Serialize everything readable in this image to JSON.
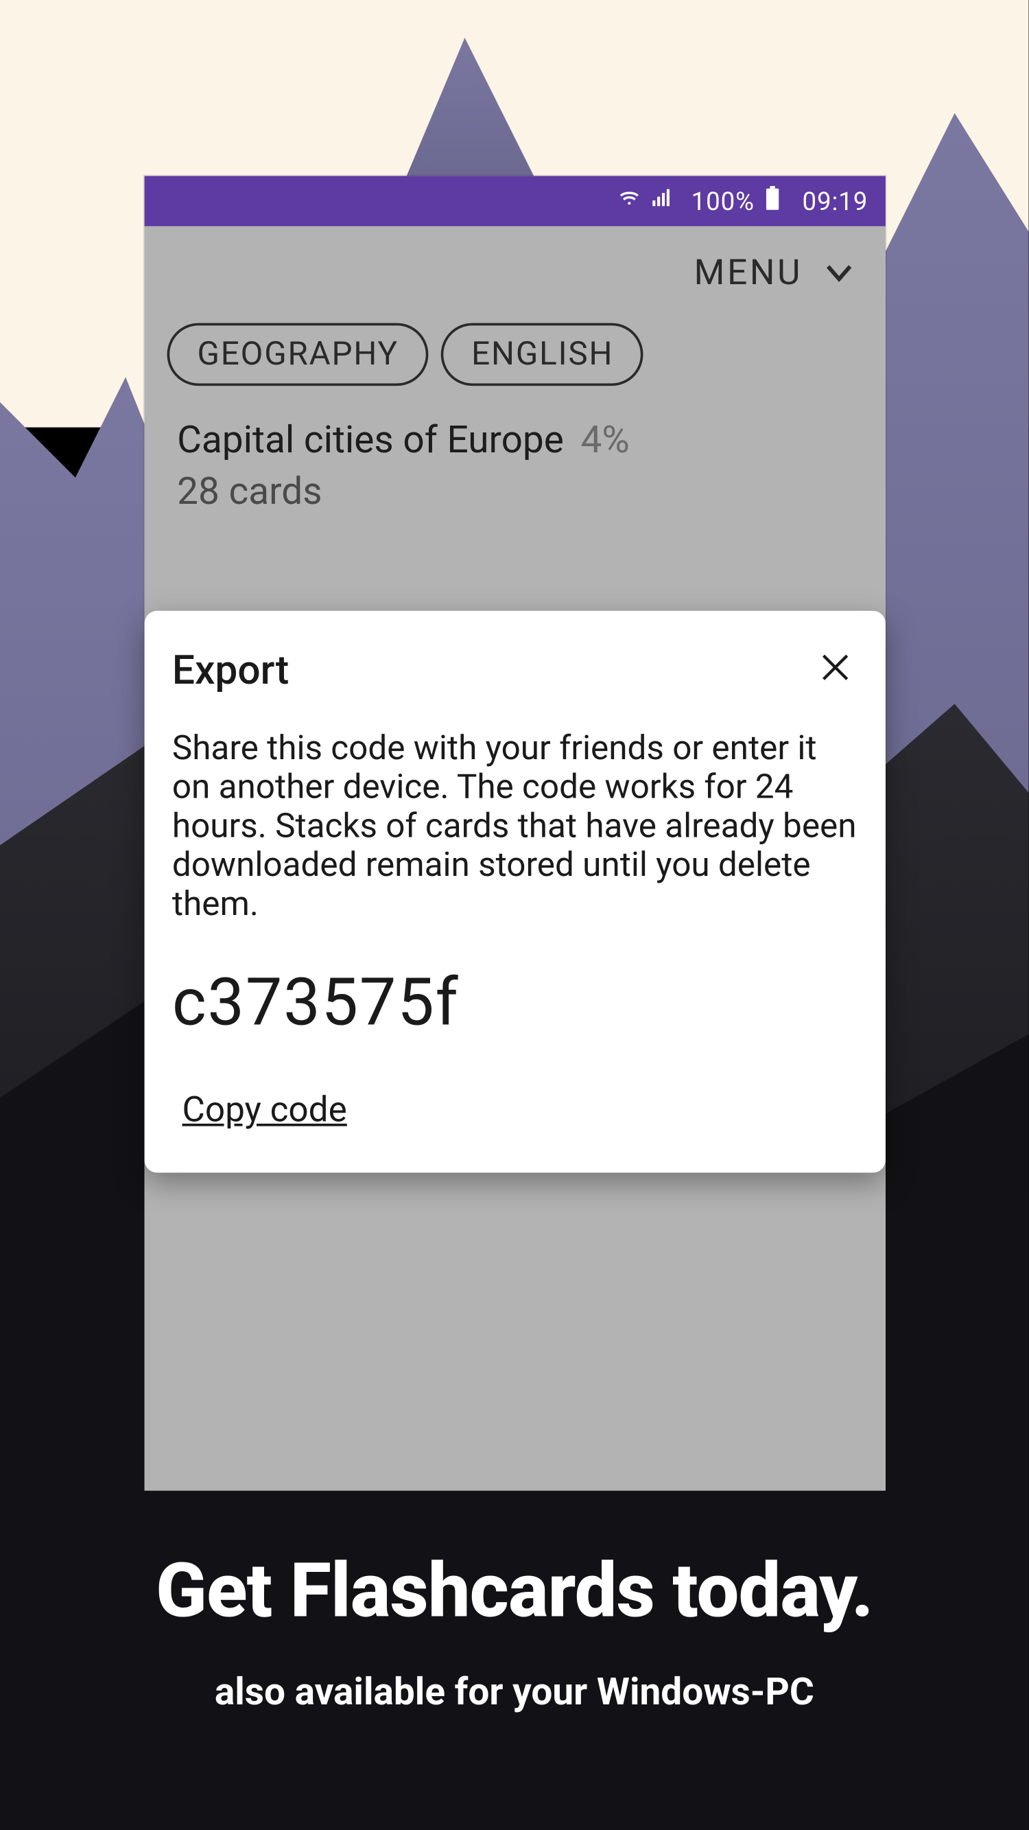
{
  "status_bar": {
    "battery_pct": "100%",
    "time": "09:19"
  },
  "app": {
    "menu_label": "MENU",
    "tags": [
      "GEOGRAPHY",
      "ENGLISH"
    ],
    "deck": {
      "title": "Capital cities of Europe",
      "progress_pct": "4%",
      "card_count": "28 cards"
    }
  },
  "dialog": {
    "title": "Export",
    "description": "Share this code with your friends or enter it on another device. The code works for 24 hours. Stacks of cards that have already been downloaded remain stored until you delete them.",
    "code": "c373575f",
    "copy_label": "Copy code"
  },
  "promo": {
    "headline": "Get Flashcards today.",
    "subline": "also available for your Windows-PC"
  }
}
